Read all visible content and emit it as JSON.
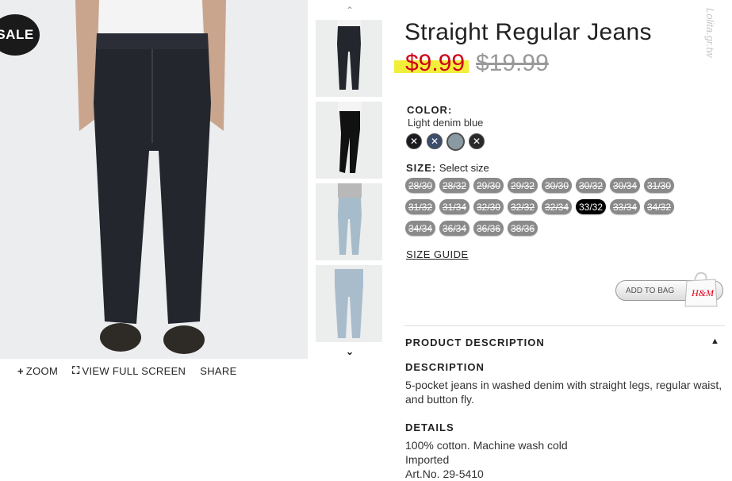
{
  "product": {
    "sale_badge": "SALE",
    "title": "Straight Regular Jeans",
    "price_sale": "$9.99",
    "price_original": "$19.99"
  },
  "watermark": "Lolita.gr.tw",
  "image_tools": {
    "zoom": "ZOOM",
    "full_screen": "VIEW FULL SCREEN",
    "share": "SHARE"
  },
  "color": {
    "label": "COLOR:",
    "value": "Light denim blue",
    "swatches": [
      {
        "name": "black",
        "hex": "#1b1b1f"
      },
      {
        "name": "dark-denim",
        "hex": "#3d4d6c"
      },
      {
        "name": "light-denim-blue",
        "hex": "#8a9aa2"
      },
      {
        "name": "black-2",
        "hex": "#2a2a2a"
      }
    ]
  },
  "size": {
    "label": "SIZE:",
    "placeholder": "Select size",
    "options": [
      "28/30",
      "28/32",
      "29/30",
      "29/32",
      "30/30",
      "30/32",
      "30/34",
      "31/30",
      "31/32",
      "31/34",
      "32/30",
      "32/32",
      "32/34",
      "33/32",
      "33/34",
      "34/32",
      "34/34",
      "36/34",
      "36/36",
      "38/36"
    ],
    "selected": "33/32"
  },
  "size_guide": "SIZE GUIDE",
  "add_to_bag": "ADD TO BAG",
  "brand_logo": "H&M",
  "description_section": {
    "header": "PRODUCT DESCRIPTION",
    "description_title": "DESCRIPTION",
    "description_text": "5-pocket jeans in washed denim with straight legs, regular waist, and button fly.",
    "details_title": "DETAILS",
    "details": [
      "100% cotton. Machine wash cold",
      "Imported",
      "Art.No. 29-5410"
    ]
  },
  "colors": {
    "sale_price": "#d0021b",
    "highlight": "#f3ee3a",
    "size_chip": "#8a8a8a",
    "size_selected": "#000000"
  }
}
